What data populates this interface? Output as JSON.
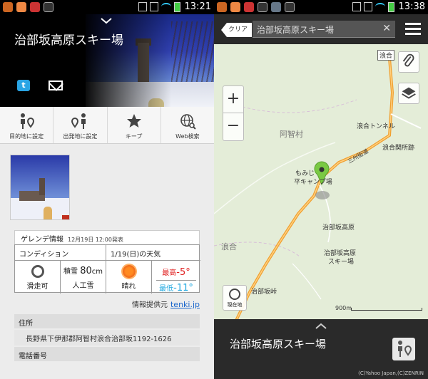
{
  "left": {
    "status": {
      "time": "13:21"
    },
    "header": {
      "title": "治部坂高原スキー場"
    },
    "actions": [
      {
        "label": "目的地に設定"
      },
      {
        "label": "出発地に設定"
      },
      {
        "label": "キープ"
      },
      {
        "label": "Web検索"
      }
    ],
    "gelande": {
      "title": "ゲレンデ情報",
      "date": "12月19日 12:00発表",
      "condition_header": "コンディション",
      "weather_header": "1/19(日)の天気",
      "status": "滑走可",
      "snow_prefix": "積雪",
      "snow_value": "80",
      "snow_unit": "cm",
      "snow_type": "人工雪",
      "weather": "晴れ",
      "max_label": "最高",
      "max_value": "-5°",
      "min_label": "最低",
      "min_value": "-11°"
    },
    "provider": {
      "label": "情報提供元",
      "link": "tenki.jp"
    },
    "address": {
      "header": "住所",
      "value": "長野県下伊那郡阿智村浪合治部坂1192-1626"
    },
    "tel": {
      "header": "電話番号"
    }
  },
  "right": {
    "status": {
      "time": "13:38"
    },
    "toolbar": {
      "clear_label": "クリア",
      "search_value": "治部坂高原スキー場"
    },
    "map_labels": {
      "namiai_sign": "浪合",
      "achi": "阿智村",
      "tunnel": "浪合トンネル",
      "sekisho": "浪合関所跡",
      "road": "三州街道",
      "momiji_1": "もみじ",
      "momiji_2": "平キャンプ場",
      "jibuzaka": "治部坂高原",
      "namiai": "浪合",
      "ski_1": "治部坂高原",
      "ski_2": "スキー場",
      "toge": "治部坂峠"
    },
    "here_label": "現在地",
    "scale": "900m",
    "sheet": {
      "name": "治部坂高原スキー場",
      "copyright": "(C)Yahoo Japan,(C)ZENRIN"
    },
    "colors": {
      "pin": "#7ac943",
      "road": "#e8a040"
    }
  }
}
